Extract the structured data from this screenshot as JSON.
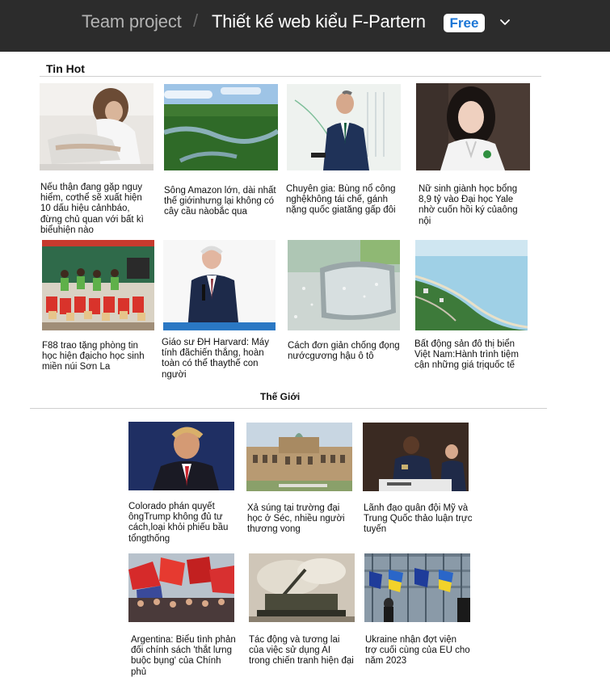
{
  "header": {
    "project": "Team project",
    "separator": "/",
    "file_name": "Thiết kế web kiểu F-Partern",
    "badge": "Free",
    "chevron_icon": "chevron-down-icon"
  },
  "sections": {
    "hot_title": "Tin Hot",
    "world_title": "Thế Giới"
  },
  "hot_articles": [
    {
      "caption": "Nếu thận đang gặp nguy hiểm, cơthể sẽ xuất hiện 10 dấu hiệu cảnhbáo, đừng chủ quan với bất kì biểuhiện nào"
    },
    {
      "caption": "Sông Amazon lớn, dài nhất thế giớinhưng lại không có cây cầu nàobắc qua"
    },
    {
      "caption": "Chuyên gia: Bùng nổ công nghệkhông tái chế, gánh nặng quốc giatăng gấp đôi"
    },
    {
      "caption": "Nữ sinh giành học bổng 8,9 tỷ vào Đại học Yale nhờ cuốn hồi ký củaông nội"
    },
    {
      "caption": "F88 trao tặng phòng tin học hiện đạicho học sinh miền núi Sơn La"
    },
    {
      "caption": "Giáo sư ĐH Harvard: Máy tính đãchiến thắng, hoàn toàn có thể thaythế con người"
    },
    {
      "caption": "Cách đơn giản chống đọng nướcgương hậu ô tô"
    },
    {
      "caption": "Bất động sản đô thị biển Việt Nam:Hành trình tiệm cận những giá trịquốc tế"
    }
  ],
  "world_articles": [
    {
      "caption": "Colorado phán quyết ôngTrump không đủ tư cách,loại khỏi phiếu bầu tổngthống"
    },
    {
      "caption": "Xả súng tại trường đại học ở Séc, nhiều người thương vong"
    },
    {
      "caption": "Lãnh đạo quân đội Mỹ và Trung Quốc thảo luận trực tuyến"
    },
    {
      "caption": "Argentina: Biểu tình phản đối chính sách 'thắt lưng buộc bụng' của Chính phủ"
    },
    {
      "caption": "Tác động và tương lai của việc sử dụng AI trong chiến tranh hiện đại"
    },
    {
      "caption": "Ukraine nhận đợt viện trợ cuối cùng của EU cho năm 2023"
    }
  ]
}
